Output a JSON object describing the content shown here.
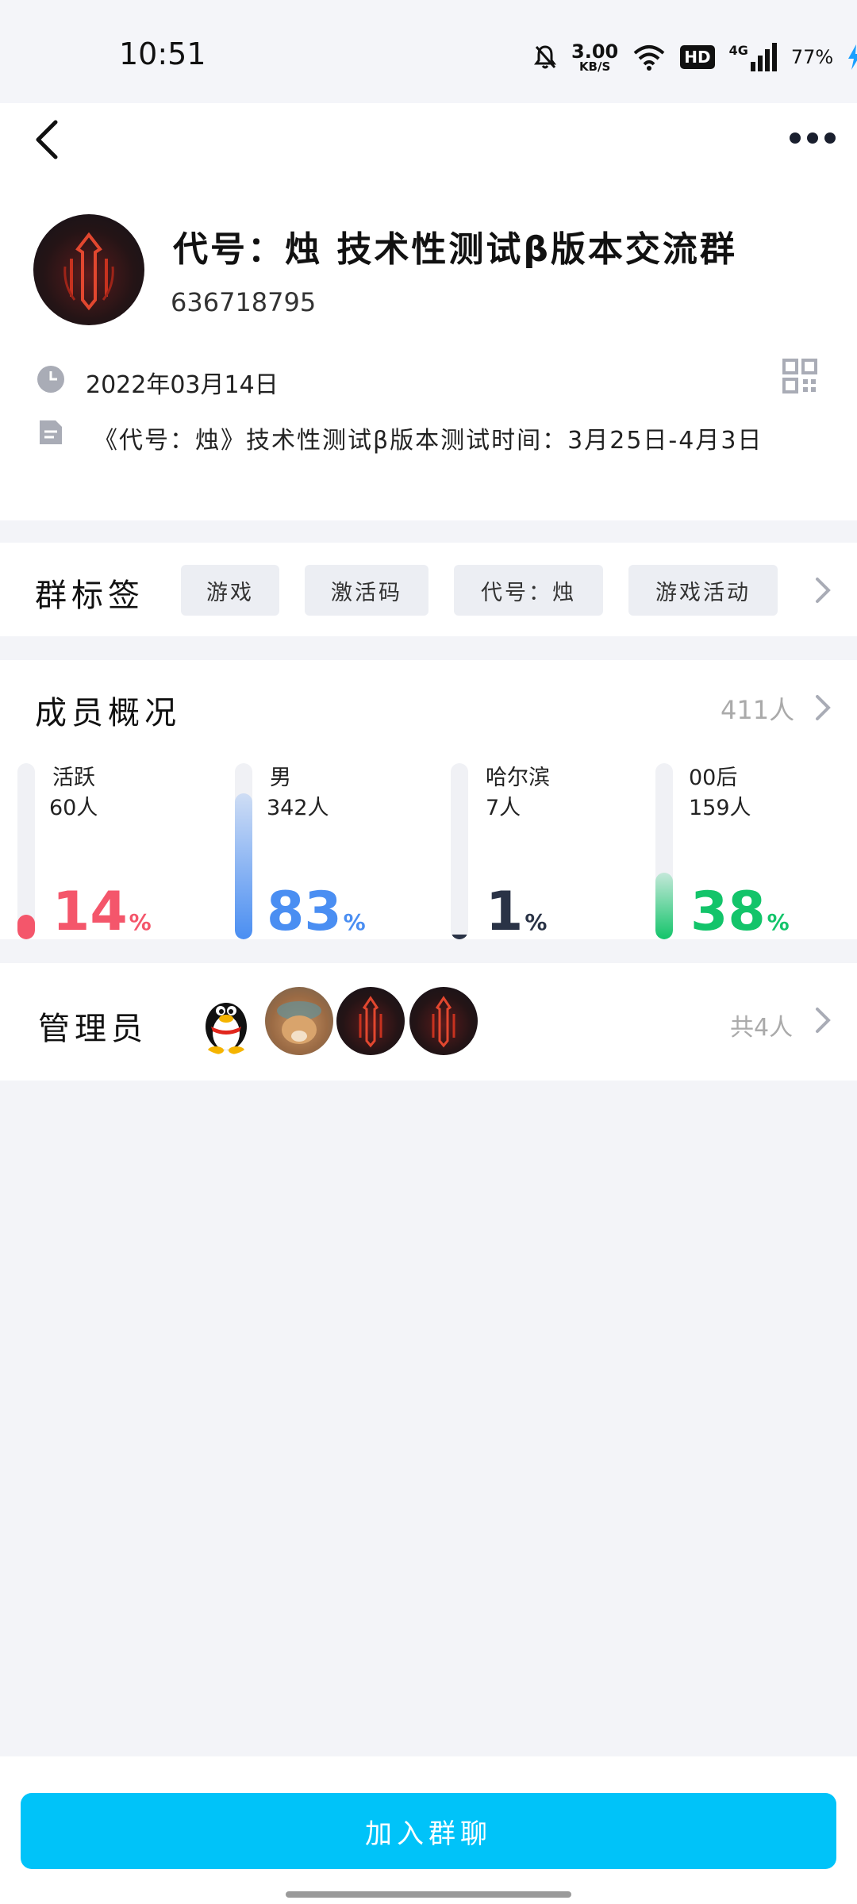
{
  "status_bar": {
    "time": "10:51",
    "speed_value": "3.00",
    "speed_unit": "KB/S",
    "hd": "HD",
    "network": "4G",
    "battery": "77%"
  },
  "group": {
    "name": "代号：烛 技术性测试β版本交流群",
    "id": "636718795",
    "date": "2022年03月14日",
    "description": "《代号：烛》技术性测试β版本测试时间：3月25日-4月3日"
  },
  "tags_section": {
    "title": "群标签",
    "tags": [
      "游戏",
      "激活码",
      "代号：烛",
      "游戏活动"
    ]
  },
  "members": {
    "title": "成员概况",
    "count": "411人",
    "stats": [
      {
        "label": "活跃",
        "sub": "60人",
        "percent": 14,
        "color": "#f4566b"
      },
      {
        "label": "男",
        "sub": "342人",
        "percent": 83,
        "color": "#4a8ef2"
      },
      {
        "label": "哈尔滨",
        "sub": "7人",
        "percent": 1,
        "color": "#2a3346"
      },
      {
        "label": "00后",
        "sub": "159人",
        "percent": 38,
        "color": "#13c46a"
      }
    ],
    "percent_sign": "%"
  },
  "admins": {
    "title": "管理员",
    "total": "共4人"
  },
  "join_button": {
    "label": "加入群聊"
  },
  "colors": {
    "accent": "#00c3f9",
    "background": "#f3f4f8"
  }
}
